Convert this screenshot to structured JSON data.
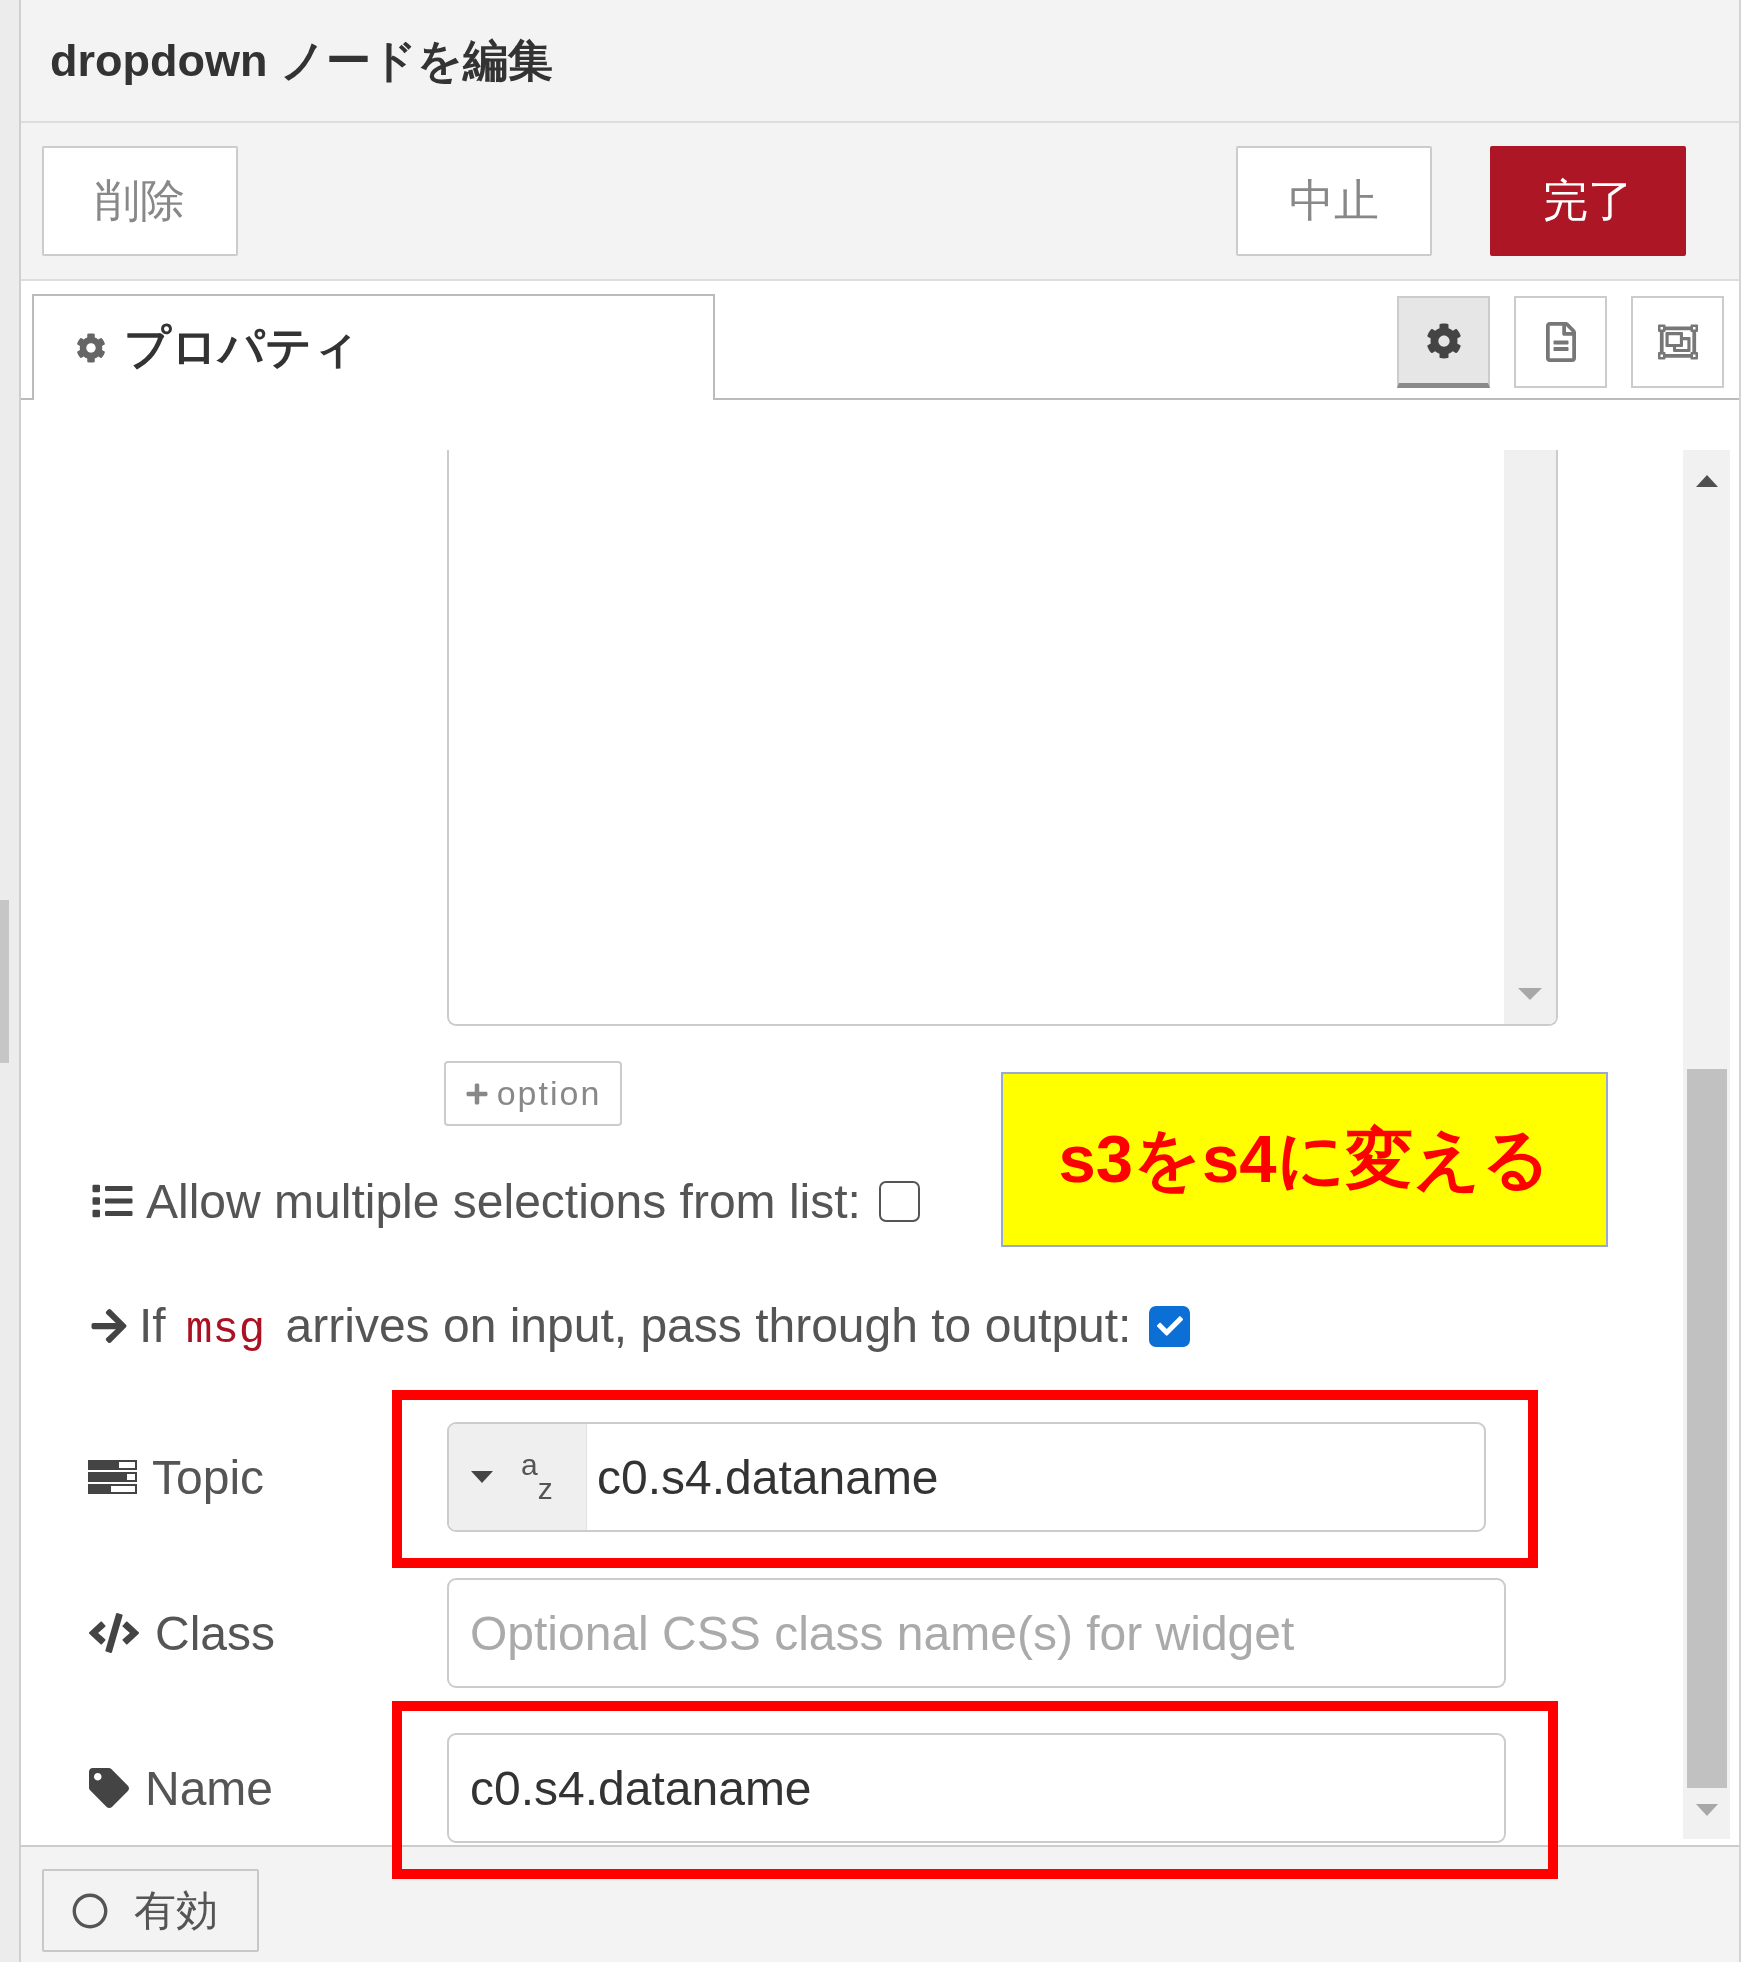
{
  "dialog": {
    "title": "dropdown ノードを編集"
  },
  "toolbar": {
    "left": [
      {
        "label": "削除",
        "kind": "default"
      }
    ],
    "right": [
      {
        "label": "中止",
        "kind": "default"
      },
      {
        "label": "完了",
        "kind": "primary"
      }
    ]
  },
  "tabs": [
    {
      "label": "プロパティ",
      "selected": true
    }
  ],
  "side_tabs": [
    {
      "selected": true
    },
    {
      "selected": false
    },
    {
      "selected": false
    }
  ],
  "add_option": {
    "label": "option"
  },
  "fields": [
    {
      "kind": "checkbox",
      "label_parts": [
        {
          "kind": "text",
          "text": "Allow multiple selections from list:"
        }
      ],
      "checked": false
    },
    {
      "kind": "checkbox",
      "label_parts": [
        {
          "kind": "text",
          "text": "If"
        },
        {
          "kind": "code",
          "text": "msg"
        },
        {
          "kind": "text",
          "text": "arrives on input, pass through to output:"
        }
      ],
      "checked": true
    },
    {
      "kind": "typed-input",
      "label": "Topic",
      "type_label": "$^{a}$$_{z}$",
      "value": "c0.s4.dataname",
      "highlighted": true
    },
    {
      "kind": "text-input",
      "label": "Class",
      "placeholder": "Optional CSS class name(s) for widget"
    },
    {
      "kind": "text-input",
      "label": "Name",
      "value": "c0.s4.dataname",
      "highlighted": true
    }
  ],
  "note": {
    "text": "s3をs4に変える"
  },
  "footer": {
    "button": {
      "label": "有効"
    }
  }
}
